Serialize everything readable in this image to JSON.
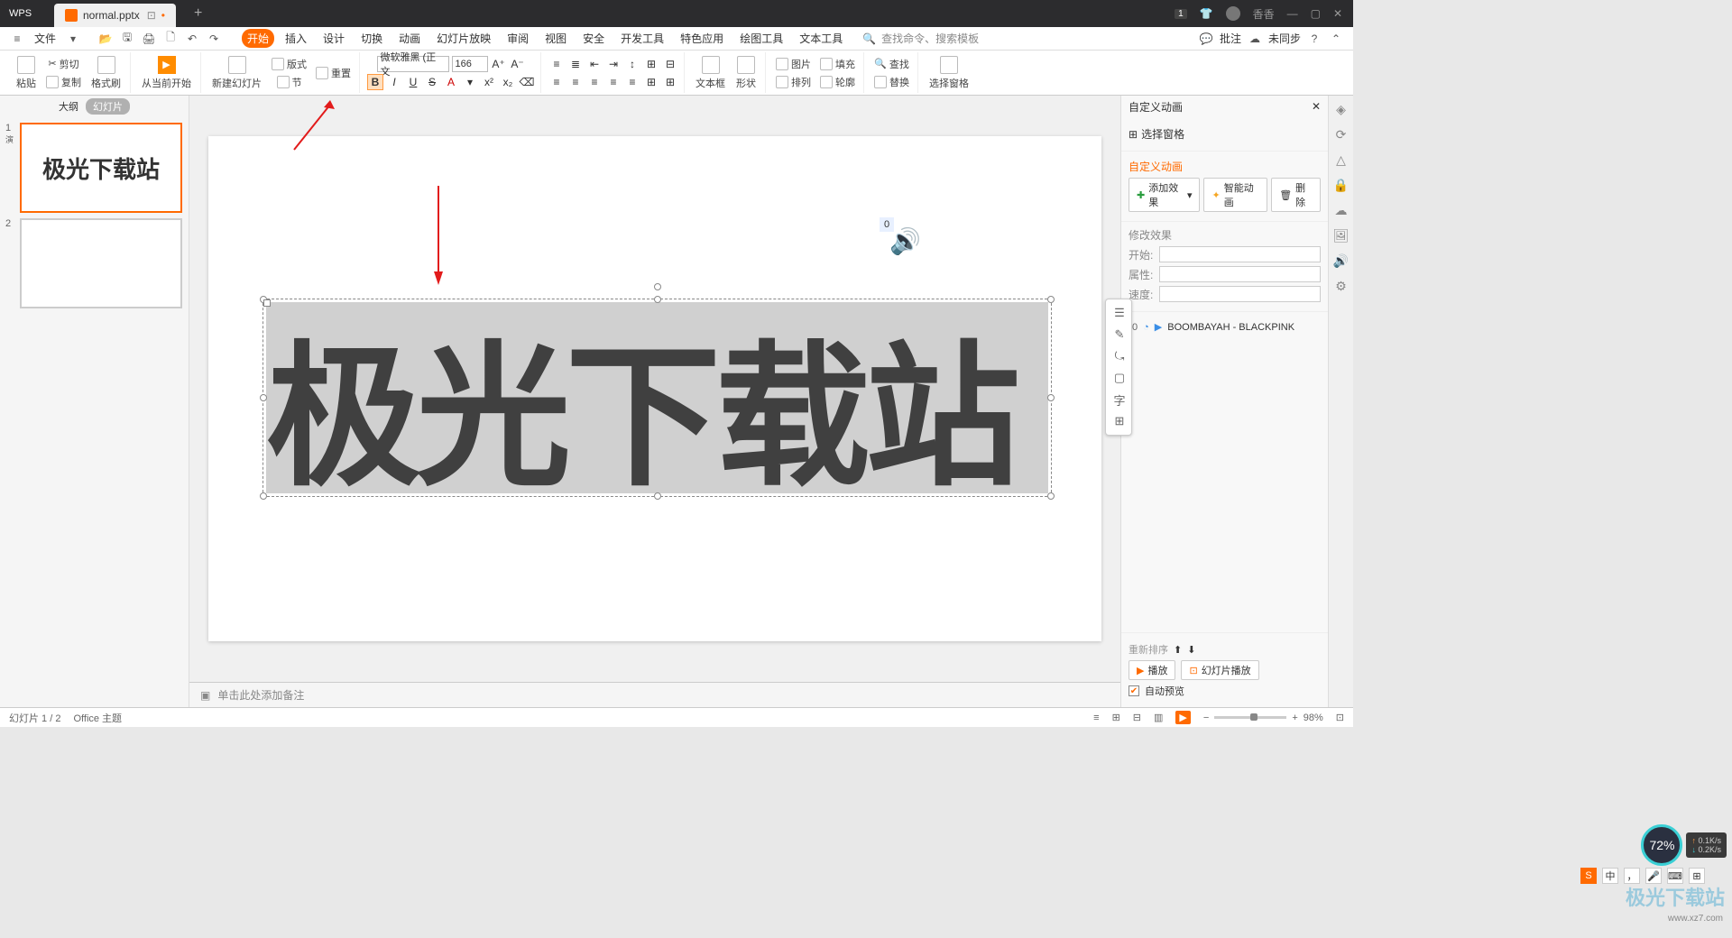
{
  "titlebar": {
    "app_name": "WPS",
    "tab_filename": "normal.pptx",
    "tab_close": "×",
    "new_tab": "+",
    "notif_badge": "1",
    "username": "香香"
  },
  "menubar": {
    "file": "文件",
    "tabs": [
      "开始",
      "插入",
      "设计",
      "切换",
      "动画",
      "幻灯片放映",
      "审阅",
      "视图",
      "安全",
      "开发工具",
      "特色应用",
      "绘图工具",
      "文本工具"
    ],
    "search_placeholder": "查找命令、搜索模板",
    "comment_btn": "批注",
    "sync_btn": "未同步"
  },
  "ribbon": {
    "paste": "粘贴",
    "cut": "剪切",
    "copy": "复制",
    "format_painter": "格式刷",
    "from_beginning": "从当前开始",
    "new_slide": "新建幻灯片",
    "layout": "版式",
    "section": "节",
    "reset": "重置",
    "font_name": "微软雅黑 (正文",
    "font_size": "166",
    "textbox": "文本框",
    "shapes": "形状",
    "arrange": "排列",
    "picture": "图片",
    "fill": "填充",
    "outline": "轮廓",
    "find": "查找",
    "replace": "替换",
    "select_pane": "选择窗格"
  },
  "outline": {
    "tab1": "大纲",
    "tab2": "幻灯片",
    "slide1_num": "1",
    "slide1_sub": "演",
    "slide1_text": "极光下载站",
    "slide2_num": "2"
  },
  "canvas": {
    "main_text": "极光下载站",
    "audio_badge": "0",
    "notes_placeholder": "单击此处添加备注"
  },
  "right_panel": {
    "title": "自定义动画",
    "select_pane": "选择窗格",
    "custom_anim": "自定义动画",
    "add_effect": "添加效果",
    "smart_anim": "智能动画",
    "delete": "删除",
    "modify_section": "修改效果",
    "start_label": "开始:",
    "attr_label": "属性:",
    "speed_label": "速度:",
    "anim_num": "0",
    "anim_name": "BOOMBAYAH - BLACKPINK",
    "reorder": "重新排序",
    "play": "播放",
    "slideshow": "幻灯片播放",
    "auto_preview": "自动预览"
  },
  "statusbar": {
    "slide_info": "幻灯片 1 / 2",
    "theme": "Office 主题",
    "zoom": "98%"
  },
  "system": {
    "cpu_pct": "72%",
    "up": "0.1K/s",
    "down": "0.2K/s",
    "ime_lang": "中",
    "ime_s": "S"
  },
  "watermark": {
    "text": "极光下载站",
    "url": "www.xz7.com"
  }
}
